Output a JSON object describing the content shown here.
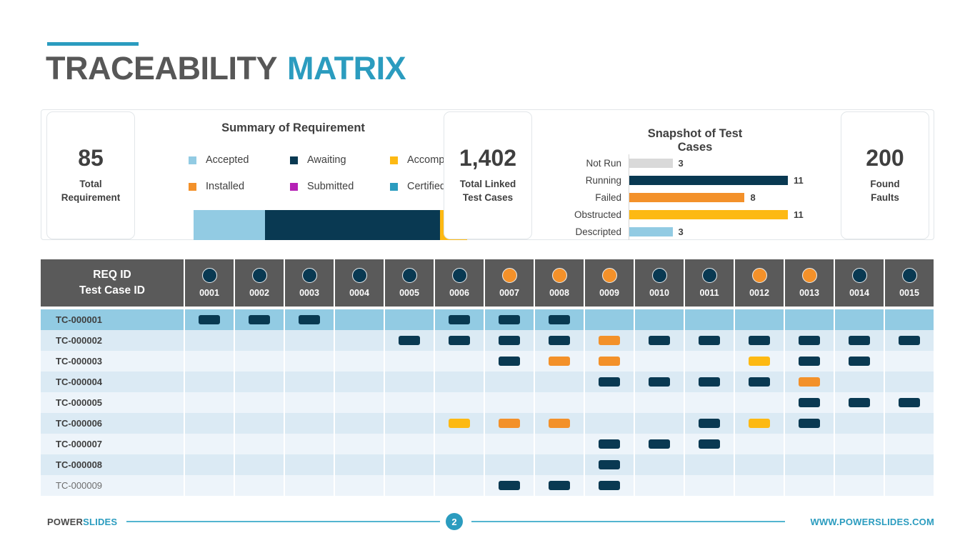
{
  "title": {
    "primary": "TRACEABILITY",
    "accent": "MATRIX"
  },
  "colors": {
    "accent": "#2b9cbf",
    "navy": "#093952",
    "light_blue": "#92cbe3",
    "orange": "#f3912a",
    "yellow": "#fdb913",
    "purple": "#b521b5",
    "teal": "#2b9cbf",
    "gray": "#d9d9d9",
    "header_gray": "#5a5a5a"
  },
  "kpis": [
    {
      "name": "total-requirement",
      "value": "85",
      "label_line1": "Total",
      "label_line2": "Requirement"
    },
    {
      "name": "total-linked-test-cases",
      "value": "1,402",
      "label_line1": "Total Linked",
      "label_line2": "Test Cases"
    },
    {
      "name": "found-faults",
      "value": "200",
      "label_line1": "Found",
      "label_line2": "Faults"
    }
  ],
  "summary": {
    "title": "Summary of Requirement",
    "legend": [
      {
        "label": "Accepted",
        "color": "#92cbe3"
      },
      {
        "label": "Awaiting",
        "color": "#093952"
      },
      {
        "label": "Accomplished",
        "color": "#fdb913"
      },
      {
        "label": "Installed",
        "color": "#f3912a"
      },
      {
        "label": "Submitted",
        "color": "#b521b5"
      },
      {
        "label": "Certified",
        "color": "#2b9cbf"
      }
    ],
    "chart_data": {
      "type": "bar",
      "orientation": "stacked-horizontal",
      "title": "Summary of Requirement",
      "categories": [
        "Accepted",
        "Awaiting",
        "Accomplished"
      ],
      "values": [
        26,
        64,
        10
      ],
      "unit": "percent",
      "colors": [
        "#92cbe3",
        "#093952",
        "#fdb913"
      ],
      "legend_position": "top",
      "grid": false
    }
  },
  "snapshot": {
    "title_line1": "Snapshot of Test",
    "title_line2": "Cases",
    "chart_data": {
      "type": "bar",
      "orientation": "horizontal",
      "title": "Snapshot of Test Cases",
      "categories": [
        "Not Run",
        "Running",
        "Failed",
        "Obstructed",
        "Descripted"
      ],
      "values": [
        3,
        11,
        8,
        11,
        3
      ],
      "colors": [
        "#d9d9d9",
        "#093952",
        "#f3912a",
        "#fdb913",
        "#92cbe3"
      ],
      "xlabel": "",
      "ylabel": "",
      "xlim": [
        0,
        11
      ],
      "grid": false,
      "data_labels": true
    }
  },
  "matrix": {
    "header": {
      "line1": "REQ ID",
      "line2": "Test Case ID"
    },
    "columns": [
      {
        "id": "0001",
        "dot": "#093952"
      },
      {
        "id": "0002",
        "dot": "#093952"
      },
      {
        "id": "0003",
        "dot": "#093952"
      },
      {
        "id": "0004",
        "dot": "#093952"
      },
      {
        "id": "0005",
        "dot": "#093952"
      },
      {
        "id": "0006",
        "dot": "#093952"
      },
      {
        "id": "0007",
        "dot": "#f3912a"
      },
      {
        "id": "0008",
        "dot": "#f3912a"
      },
      {
        "id": "0009",
        "dot": "#f3912a"
      },
      {
        "id": "0010",
        "dot": "#093952"
      },
      {
        "id": "0011",
        "dot": "#093952"
      },
      {
        "id": "0012",
        "dot": "#f3912a"
      },
      {
        "id": "0013",
        "dot": "#f3912a"
      },
      {
        "id": "0014",
        "dot": "#093952"
      },
      {
        "id": "0015",
        "dot": "#093952"
      }
    ],
    "rows": [
      {
        "id": "TC-000001",
        "highlight": true,
        "band": "highlight",
        "muted": false,
        "cells": [
          "#093952",
          "#093952",
          "#093952",
          null,
          null,
          "#093952",
          "#093952",
          "#093952",
          null,
          null,
          null,
          null,
          null,
          null,
          null
        ]
      },
      {
        "id": "TC-000002",
        "highlight": false,
        "band": "even",
        "muted": false,
        "cells": [
          null,
          null,
          null,
          null,
          "#093952",
          "#093952",
          "#093952",
          "#093952",
          "#f3912a",
          "#093952",
          "#093952",
          "#093952",
          "#093952",
          "#093952",
          "#093952"
        ]
      },
      {
        "id": "TC-000003",
        "highlight": false,
        "band": "odd",
        "muted": false,
        "cells": [
          null,
          null,
          null,
          null,
          null,
          null,
          "#093952",
          "#f3912a",
          "#f3912a",
          null,
          null,
          "#fdb913",
          "#093952",
          "#093952",
          null
        ]
      },
      {
        "id": "TC-000004",
        "highlight": false,
        "band": "even",
        "muted": false,
        "cells": [
          null,
          null,
          null,
          null,
          null,
          null,
          null,
          null,
          "#093952",
          "#093952",
          "#093952",
          "#093952",
          "#f3912a",
          null,
          null
        ]
      },
      {
        "id": "TC-000005",
        "highlight": false,
        "band": "odd",
        "muted": false,
        "cells": [
          null,
          null,
          null,
          null,
          null,
          null,
          null,
          null,
          null,
          null,
          null,
          null,
          "#093952",
          "#093952",
          "#093952"
        ]
      },
      {
        "id": "TC-000006",
        "highlight": false,
        "band": "even",
        "muted": false,
        "cells": [
          null,
          null,
          null,
          null,
          null,
          "#fdb913",
          "#f3912a",
          "#f3912a",
          null,
          null,
          "#093952",
          "#fdb913",
          "#093952",
          null,
          null
        ]
      },
      {
        "id": "TC-000007",
        "highlight": false,
        "band": "odd",
        "muted": false,
        "cells": [
          null,
          null,
          null,
          null,
          null,
          null,
          null,
          null,
          "#093952",
          "#093952",
          "#093952",
          null,
          null,
          null,
          null
        ]
      },
      {
        "id": "TC-000008",
        "highlight": false,
        "band": "even",
        "muted": false,
        "cells": [
          null,
          null,
          null,
          null,
          null,
          null,
          null,
          null,
          "#093952",
          null,
          null,
          null,
          null,
          null,
          null
        ]
      },
      {
        "id": "TC-000009",
        "highlight": false,
        "band": "odd",
        "muted": true,
        "cells": [
          null,
          null,
          null,
          null,
          null,
          null,
          "#093952",
          "#093952",
          "#093952",
          null,
          null,
          null,
          null,
          null,
          null
        ]
      }
    ]
  },
  "footer": {
    "brand_primary": "POWER",
    "brand_accent": "SLIDES",
    "page_number": "2",
    "site_url": "WWW.POWERSLIDES.COM"
  }
}
